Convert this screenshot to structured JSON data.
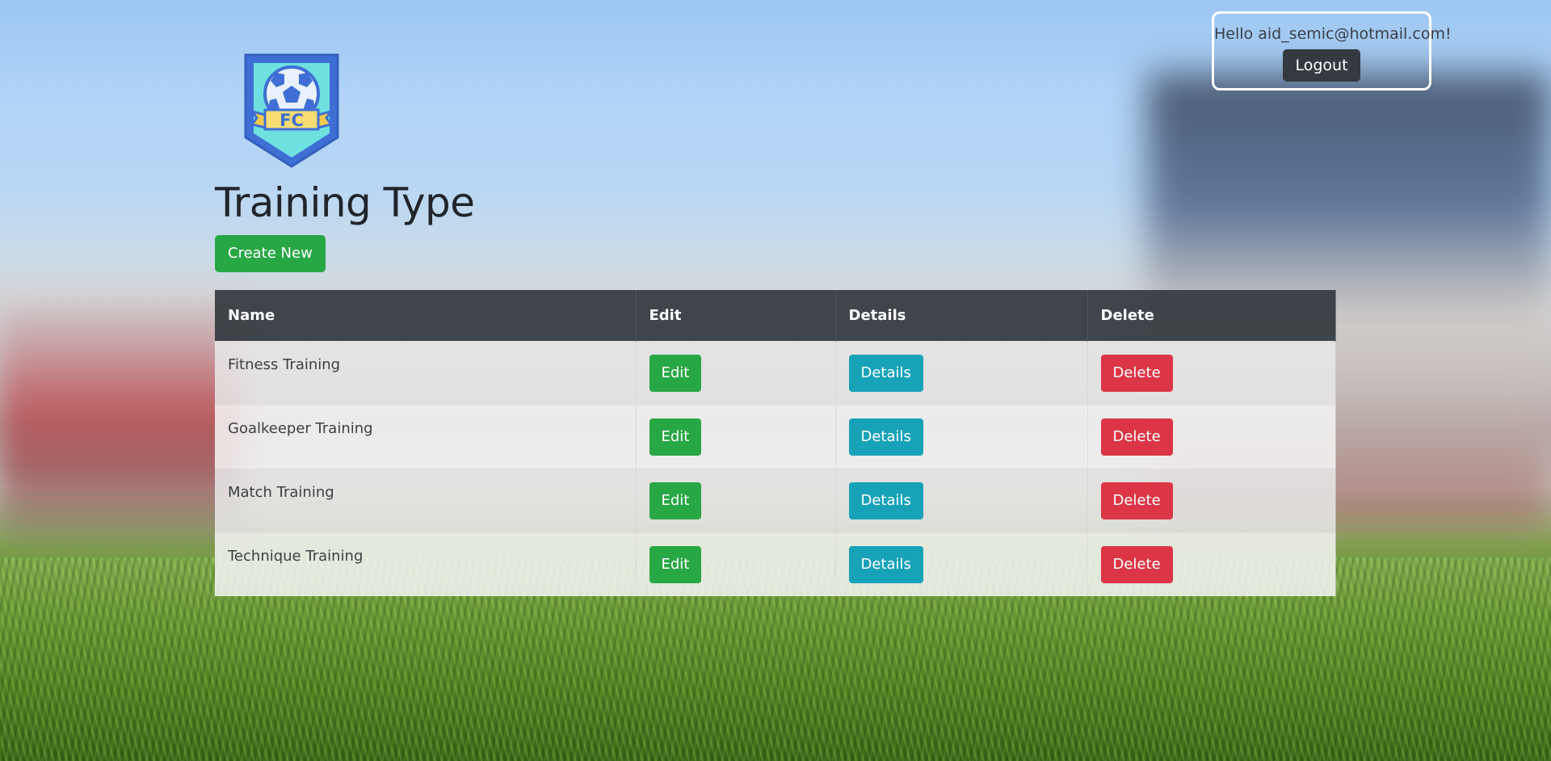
{
  "header": {
    "greeting": "Hello aid_semic@hotmail.com!",
    "logout_label": "Logout"
  },
  "logo": {
    "text": "FC",
    "icon": "football-club-crest-icon"
  },
  "page": {
    "title": "Training Type",
    "create_label": "Create New"
  },
  "table": {
    "columns": [
      "Name",
      "Edit",
      "Details",
      "Delete"
    ],
    "rows": [
      {
        "name": "Fitness Training",
        "edit": "Edit",
        "details": "Details",
        "delete": "Delete"
      },
      {
        "name": "Goalkeeper Training",
        "edit": "Edit",
        "details": "Details",
        "delete": "Delete"
      },
      {
        "name": "Match Training",
        "edit": "Edit",
        "details": "Details",
        "delete": "Delete"
      },
      {
        "name": "Technique Training",
        "edit": "Edit",
        "details": "Details",
        "delete": "Delete"
      }
    ]
  },
  "colors": {
    "edit": "#28a745",
    "details": "#17a2b8",
    "delete": "#dc3545",
    "dark": "#343a40"
  }
}
